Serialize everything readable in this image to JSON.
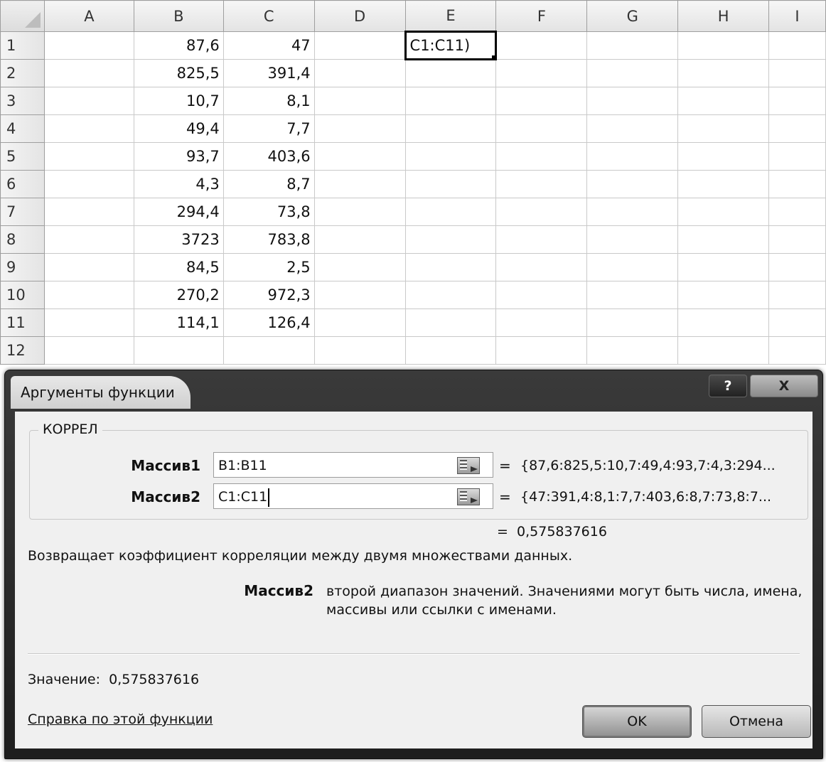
{
  "sheet": {
    "columns": [
      "A",
      "B",
      "C",
      "D",
      "E",
      "F",
      "G",
      "H",
      "I"
    ],
    "rows": [
      {
        "n": "1",
        "b": "87,6",
        "c": "47"
      },
      {
        "n": "2",
        "b": "825,5",
        "c": "391,4"
      },
      {
        "n": "3",
        "b": "10,7",
        "c": "8,1"
      },
      {
        "n": "4",
        "b": "49,4",
        "c": "7,7"
      },
      {
        "n": "5",
        "b": "93,7",
        "c": "403,6"
      },
      {
        "n": "6",
        "b": "4,3",
        "c": "8,7"
      },
      {
        "n": "7",
        "b": "294,4",
        "c": "73,8"
      },
      {
        "n": "8",
        "b": "3723",
        "c": "783,8"
      },
      {
        "n": "9",
        "b": "84,5",
        "c": "2,5"
      },
      {
        "n": "10",
        "b": "270,2",
        "c": "972,3"
      },
      {
        "n": "11",
        "b": "114,1",
        "c": "126,4"
      },
      {
        "n": "12",
        "b": "",
        "c": ""
      }
    ],
    "active_cell_text": "C1:C11)"
  },
  "dialog": {
    "title": "Аргументы функции",
    "help_button": "?",
    "close_button": "X",
    "function_name": "КОРРЕЛ",
    "args": [
      {
        "label": "Массив1",
        "value": "B1:B11",
        "result": "{87,6:825,5:10,7:49,4:93,7:4,3:294..."
      },
      {
        "label": "Массив2",
        "value": "C1:C11",
        "result": "{47:391,4:8,1:7,7:403,6:8,7:73,8:7..."
      }
    ],
    "equals": "=",
    "formula_result": "0,575837616",
    "description": "Возвращает коэффициент корреляции между двумя множествами данных.",
    "param_name": "Массив2",
    "param_description": "второй диапазон значений. Значениями могут быть числа, имена, массивы или ссылки с именами.",
    "value_label": "Значение:",
    "value": "0,575837616",
    "help_link": "Справка по этой функции",
    "ok_button": "OK",
    "cancel_button": "Отмена"
  }
}
